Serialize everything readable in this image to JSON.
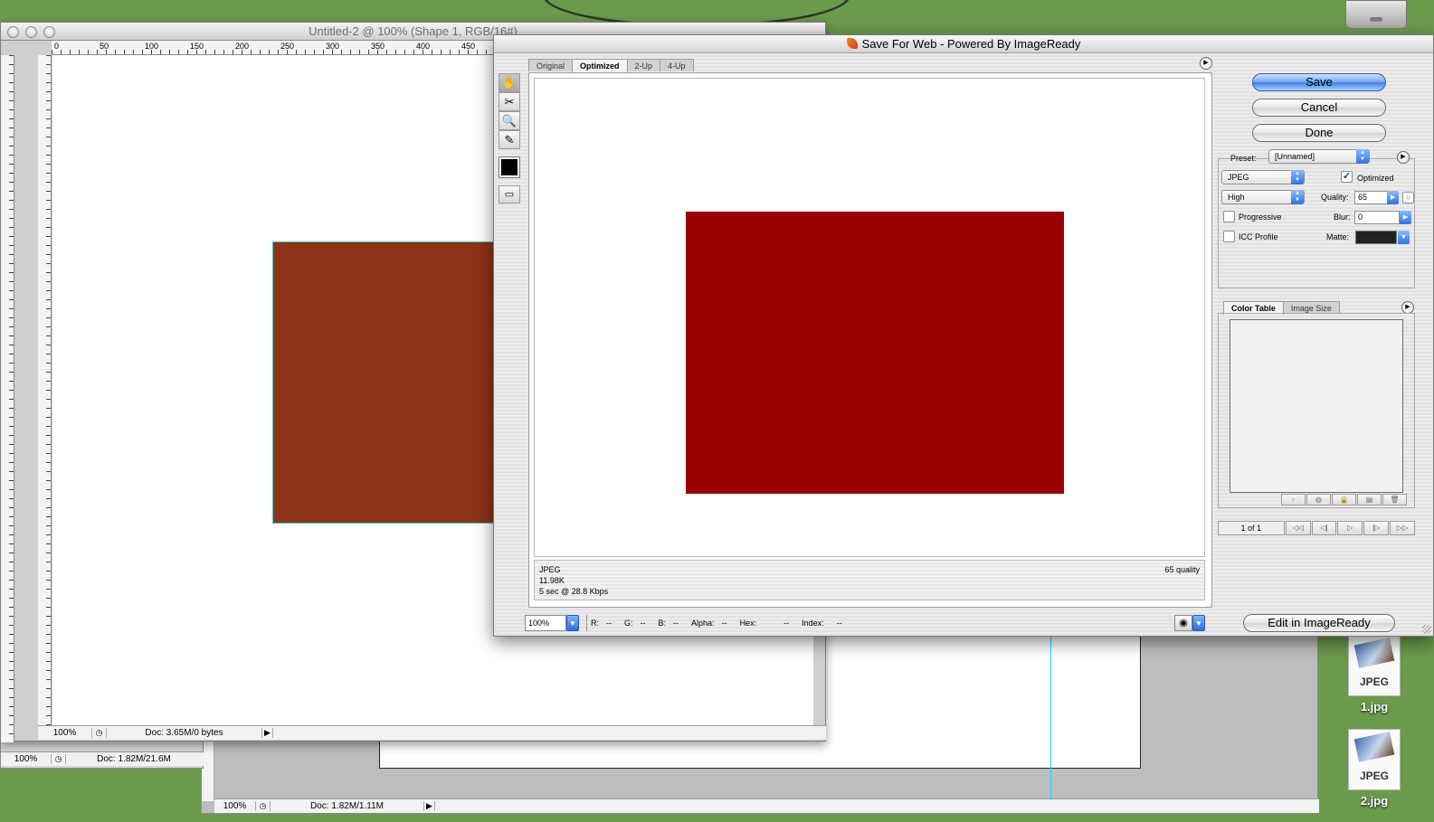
{
  "desktop": {
    "icons": [
      {
        "ext": "JPEG",
        "name": "1.jpg"
      },
      {
        "ext": "JPEG",
        "name": "2.jpg"
      }
    ]
  },
  "back_windows": {
    "w3": {
      "zoom": "100%",
      "doc": "Doc: 1.82M/1.11M"
    },
    "w2": {
      "zoom": "100%",
      "doc": "Doc: 1.82M/21.6M"
    }
  },
  "doc_window": {
    "title": "Untitled-2 @ 100% (Shape 1, RGB/16#)",
    "ruler_ticks": [
      "0",
      "50",
      "100",
      "150",
      "200",
      "250",
      "300",
      "350",
      "400",
      "450"
    ],
    "status": {
      "zoom": "100%",
      "doc": "Doc: 3.65M/0 bytes"
    },
    "shape_color": "#8c3318"
  },
  "sfw": {
    "title": "Save For Web - Powered By ImageReady",
    "tabs": [
      "Original",
      "Optimized",
      "2-Up",
      "4-Up"
    ],
    "preview_color": "#990000",
    "annotation": {
      "format": "JPEG",
      "size": "11.98K",
      "time": "5 sec @ 28.8 Kbps",
      "quality": "65 quality"
    },
    "bottom": {
      "zoom": "100%",
      "readout": [
        "R:",
        "--",
        "G:",
        "--",
        "B:",
        "--",
        "Alpha:",
        "--",
        "Hex:",
        "--",
        "Index:",
        "--"
      ]
    },
    "buttons": {
      "save": "Save",
      "cancel": "Cancel",
      "done": "Done",
      "edit": "Edit in ImageReady"
    },
    "settings": {
      "preset_label": "Preset:",
      "preset_value": "[Unnamed]",
      "format": "JPEG",
      "quality_level": "High",
      "optimized_label": "Optimized",
      "optimized_checked": "✓",
      "quality_label": "Quality:",
      "quality_value": "65",
      "blur_label": "Blur:",
      "blur_value": "0",
      "progressive_label": "Progressive",
      "icc_label": "ICC Profile",
      "matte_label": "Matte:"
    },
    "color_tabs": [
      "Color Table",
      "Image Size"
    ],
    "animation": {
      "frames": "1 of 1"
    }
  }
}
